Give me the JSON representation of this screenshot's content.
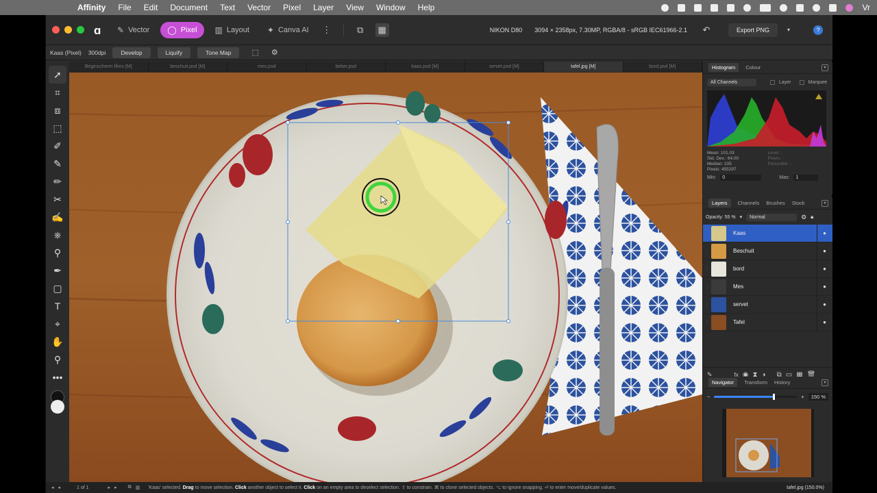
{
  "menubar": {
    "app": "Affinity",
    "items": [
      "File",
      "Edit",
      "Document",
      "Text",
      "Vector",
      "Pixel",
      "Layer",
      "View",
      "Window",
      "Help"
    ],
    "user_initials": "Vr"
  },
  "titlebar": {
    "personas": [
      {
        "label": "Vector",
        "active": false
      },
      {
        "label": "Pixel",
        "active": true
      },
      {
        "label": "Layout",
        "active": false
      },
      {
        "label": "Canva AI",
        "active": false
      }
    ],
    "camera": "NIKON D80",
    "doc_info": "3094 × 2358px, 7.30MP, RGBA/8 - sRGB IEC61966-2.1",
    "export_label": "Export PNG",
    "help_label": "?"
  },
  "contextbar": {
    "layer_info": "Kaas (Pixel)",
    "dpi": "300dpi",
    "buttons": [
      "Develop",
      "Liquify",
      "Tone Map"
    ]
  },
  "doc_tabs": [
    {
      "label": "Beginscherm films [M]",
      "active": false
    },
    {
      "label": "beschuit.psd [M]",
      "active": false
    },
    {
      "label": "mes.psd",
      "active": false
    },
    {
      "label": "beker.psd",
      "active": false
    },
    {
      "label": "kaas.psd [M]",
      "active": false
    },
    {
      "label": "servet.psd [M]",
      "active": false
    },
    {
      "label": "tafel.jpg [M]",
      "active": true
    },
    {
      "label": "bord.psd [M]",
      "active": false
    }
  ],
  "histogram_panel": {
    "tabs": [
      "Histogram",
      "Colour"
    ],
    "channels": "All Channels",
    "layer_label": "Layer",
    "marquee_label": "Marquee",
    "mean": "Mean: 101.03",
    "std_dev": "Std. Dev.: 64.00",
    "median": "Median: 105",
    "pixels": "Pixels: 455297",
    "level": "Level: -",
    "pixels_right": "Pixels: -",
    "percentile": "Percentile: -",
    "min_label": "Min:",
    "min_value": "0",
    "max_label": "Max:",
    "max_value": "1"
  },
  "layers_panel": {
    "tabs": [
      "Layers",
      "Channels",
      "Brushes",
      "Stock"
    ],
    "opacity": "Opacity: 55 %",
    "blend_mode": "Normal",
    "layers": [
      {
        "name": "Kaas",
        "selected": true,
        "thumb_color": "#d6c88a"
      },
      {
        "name": "Beschuit",
        "selected": false,
        "thumb_color": "#d49a45"
      },
      {
        "name": "bord",
        "selected": false,
        "thumb_color": "#e8e6dc"
      },
      {
        "name": "Mes",
        "selected": false,
        "thumb_color": "#3b3b3b"
      },
      {
        "name": "servet",
        "selected": false,
        "thumb_color": "#2c52a0"
      },
      {
        "name": "Tafel",
        "selected": false,
        "thumb_color": "#8a4e22"
      }
    ]
  },
  "navigator_panel": {
    "tabs": [
      "Navigator",
      "Transform",
      "History"
    ],
    "zoom_value": "150 %",
    "zoom_fraction": 0.72
  },
  "statusbar": {
    "page": "1 of 1",
    "hint_parts": [
      {
        "t": "'Kaas' selected. ",
        "b": false
      },
      {
        "t": "Drag",
        "b": true
      },
      {
        "t": " to move selection. ",
        "b": false
      },
      {
        "t": "Click",
        "b": true
      },
      {
        "t": " another object to select it. ",
        "b": false
      },
      {
        "t": "Click",
        "b": true
      },
      {
        "t": " on an empty area to deselect selection. ",
        "b": false
      },
      {
        "t": "⇧ to constrain. ⌘ to clone selected objects. ⌥ to ignore snapping. ⏎ to enter move/duplicate values.",
        "b": false
      }
    ],
    "doc": "tafel.jpg (150.0%)"
  },
  "colors": {
    "accent_pixel": "#c74fd6",
    "selection_blue": "#2f5fc4",
    "table_wood": "#8a4e22"
  }
}
